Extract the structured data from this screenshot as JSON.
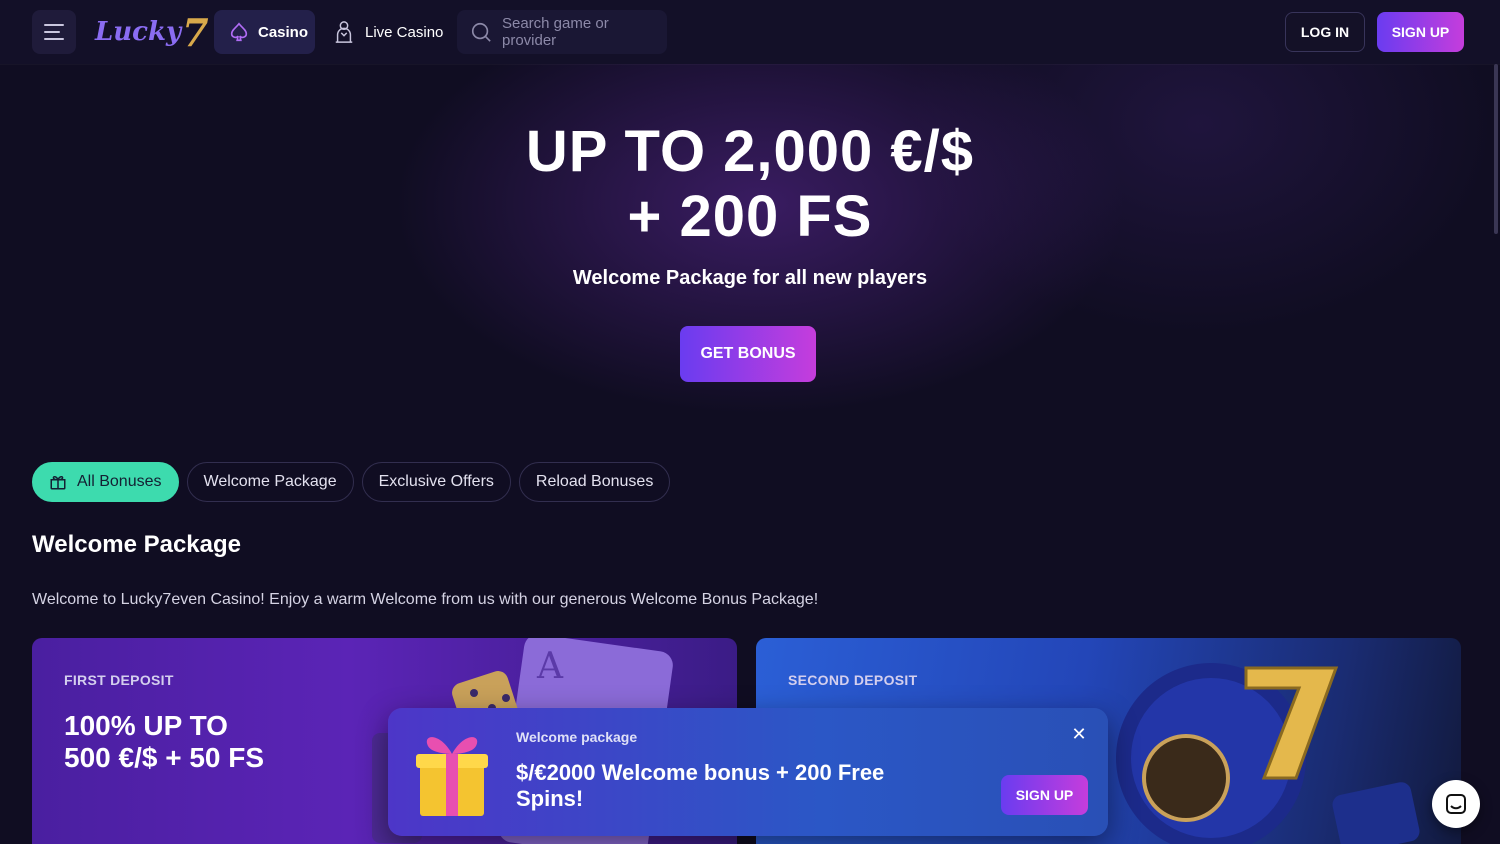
{
  "header": {
    "logo_text": "Lucky",
    "logo_seven": "7",
    "nav_casino": "Casino",
    "nav_live_casino": "Live Casino",
    "search_placeholder": "Search game or provider",
    "login_label": "LOG IN",
    "signup_label": "SIGN UP"
  },
  "hero": {
    "title_line1": "UP TO 2,000 €/$",
    "title_line2": "+ 200 FS",
    "subtitle": "Welcome Package for all new players",
    "cta_label": "GET BONUS"
  },
  "filters": [
    {
      "label": "All Bonuses",
      "active": true
    },
    {
      "label": "Welcome Package",
      "active": false
    },
    {
      "label": "Exclusive Offers",
      "active": false
    },
    {
      "label": "Reload Bonuses",
      "active": false
    }
  ],
  "section": {
    "title": "Welcome Package",
    "description": "Welcome to Lucky7even Casino! Enjoy a warm Welcome from us with our generous Welcome Bonus Package!"
  },
  "cards": [
    {
      "label": "FIRST DEPOSIT",
      "title_line1": "100% UP TO",
      "title_line2": "500 €/$ + 50 FS"
    },
    {
      "label": "SECOND DEPOSIT"
    }
  ],
  "popup": {
    "label": "Welcome package",
    "title": "$/€2000 Welcome bonus + 200 Free Spins!",
    "signup_label": "SIGN UP",
    "close_symbol": "✕"
  },
  "colors": {
    "accent_gradient_start": "#6a3cf0",
    "accent_gradient_end": "#c53ddc",
    "active_chip": "#3ddbae",
    "background": "#100d22"
  }
}
